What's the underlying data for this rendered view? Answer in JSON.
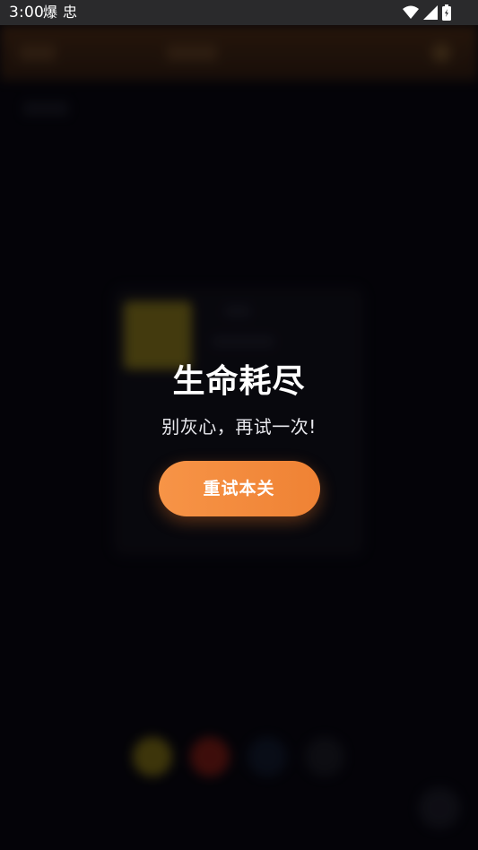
{
  "status_bar": {
    "time": "3:00",
    "left_icons": [
      "爆",
      "忠"
    ],
    "right_icons": [
      "wifi-icon",
      "signal-icon",
      "battery-icon"
    ]
  },
  "dialog": {
    "title": "生命耗尽",
    "subtitle": "别灰心，再试一次!",
    "retry_label": "重试本关"
  },
  "colors": {
    "accent": "#f08a3c",
    "background": "#06050a",
    "header_tint": "#3a2210"
  }
}
